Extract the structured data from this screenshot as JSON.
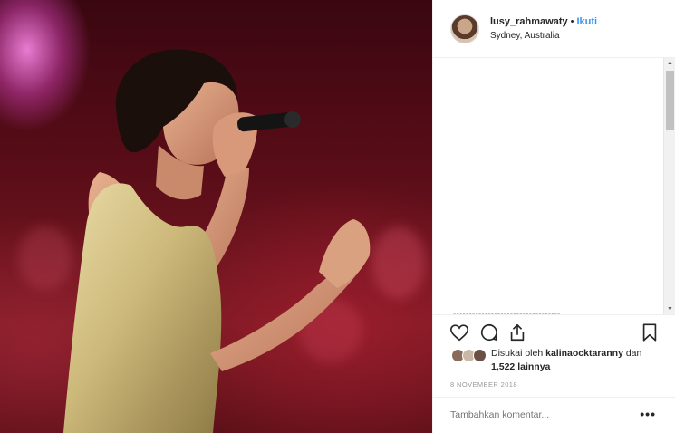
{
  "post": {
    "username": "lusy_rahmawaty",
    "separator": "•",
    "follow_label": "Ikuti",
    "location": "Sydney, Australia"
  },
  "actions": {
    "like_icon": "heart-icon",
    "comment_icon": "comment-icon",
    "share_icon": "share-icon",
    "save_icon": "bookmark-icon"
  },
  "likes": {
    "prefix": "Disukai oleh",
    "liker": "kalinaocktaranny",
    "conjunction": "dan",
    "others": "1,522 lainnya"
  },
  "date": "8 NOVEMBER 2018",
  "comment_box": {
    "placeholder": "Tambahkan komentar..."
  },
  "more_label": "•••",
  "colors": {
    "link": "#3897f0",
    "border": "#efefef"
  }
}
